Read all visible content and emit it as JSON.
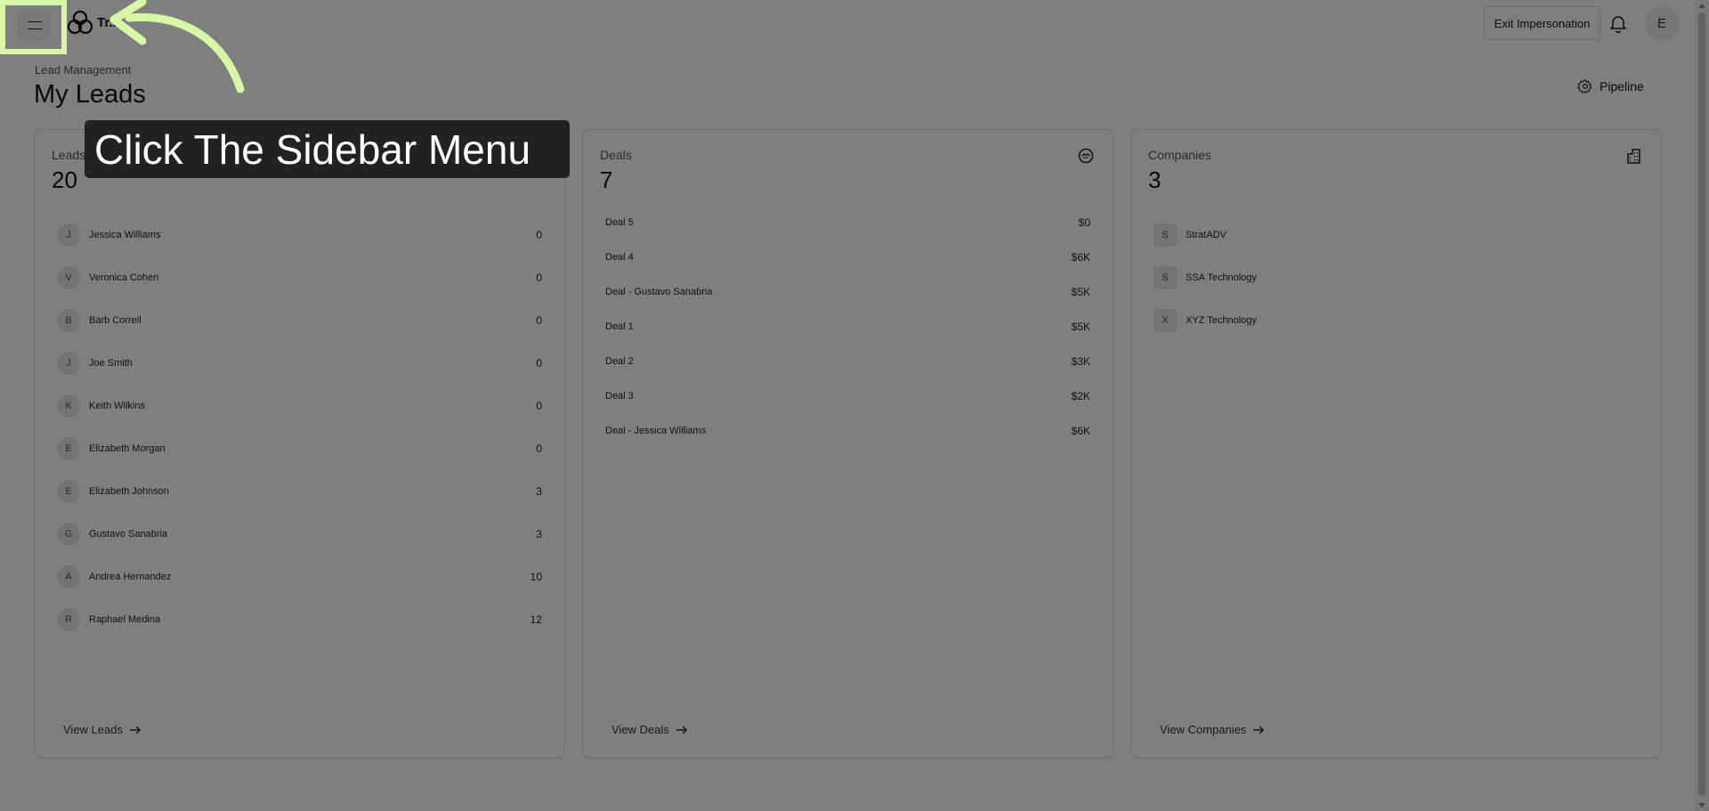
{
  "topbar": {
    "brand": "Tr...",
    "exit_label": "Exit Impersonation",
    "user_initial": "E",
    "menu_icon": "hamburger-icon",
    "bell_icon": "bell-icon"
  },
  "header": {
    "breadcrumb": "Lead Management",
    "title": "My Leads",
    "pipeline_label": "Pipeline",
    "pipeline_icon": "gear-icon"
  },
  "leads_card": {
    "label": "Leads",
    "count": "20",
    "items": [
      {
        "initial": "J",
        "name": "Jessica Williams",
        "value": "0"
      },
      {
        "initial": "V",
        "name": "Veronica Cohen",
        "value": "0"
      },
      {
        "initial": "B",
        "name": "Barb Correll",
        "value": "0"
      },
      {
        "initial": "J",
        "name": "Joe Smith",
        "value": "0"
      },
      {
        "initial": "K",
        "name": "Keith Wilkins",
        "value": "0"
      },
      {
        "initial": "E",
        "name": "Elizabeth Morgan",
        "value": "0"
      },
      {
        "initial": "E",
        "name": "Elizabeth Johnson",
        "value": "3"
      },
      {
        "initial": "G",
        "name": "Gustavo Sanabria",
        "value": "3"
      },
      {
        "initial": "A",
        "name": "Andrea Hernandez",
        "value": "10"
      },
      {
        "initial": "R",
        "name": "Raphael Medina",
        "value": "12"
      }
    ],
    "view_label": "View Leads"
  },
  "deals_card": {
    "label": "Deals",
    "count": "7",
    "icon": "handshake-icon",
    "items": [
      {
        "name": "Deal 5",
        "value": "$0"
      },
      {
        "name": "Deal 4",
        "value": "$6K"
      },
      {
        "name": "Deal - Gustavo Sanabria",
        "value": "$5K"
      },
      {
        "name": "Deal 1",
        "value": "$5K"
      },
      {
        "name": "Deal 2",
        "value": "$3K"
      },
      {
        "name": "Deal 3",
        "value": "$2K"
      },
      {
        "name": "Deal - Jessica Williams",
        "value": "$6K"
      }
    ],
    "view_label": "View Deals"
  },
  "companies_card": {
    "label": "Companies",
    "count": "3",
    "icon": "building-icon",
    "items": [
      {
        "initial": "S",
        "name": "StratADV"
      },
      {
        "initial": "S",
        "name": "SSA Technology"
      },
      {
        "initial": "X",
        "name": "XYZ Technology"
      }
    ],
    "view_label": "View Companies"
  },
  "overlay": {
    "callout_text": "Click The Sidebar Menu",
    "highlight_color": "#d7f7a6"
  }
}
